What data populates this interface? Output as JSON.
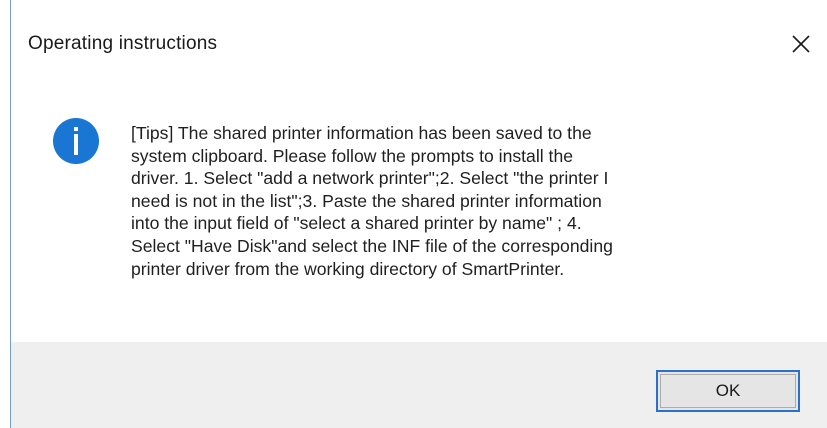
{
  "dialog": {
    "title": "Operating instructions",
    "close_icon": "close-icon",
    "info_icon": "info-icon",
    "message": "[Tips] The shared printer information has been saved to the\nsystem clipboard. Please follow the prompts  to install the\ndriver. 1. Select \"add a network printer\";2. Select \"the printer I\nneed is not in the list\";3. Paste the shared printer information\ninto the input field of \"select a shared printer by name\" ; 4.\nSelect \"Have Disk\"and select the INF file of the corresponding\nprinter driver from the working directory of SmartPrinter.",
    "ok_label": "OK"
  },
  "colors": {
    "accent": "#2a72c8",
    "info_icon_bg": "#1976d2",
    "footer_bg": "#efefef"
  }
}
